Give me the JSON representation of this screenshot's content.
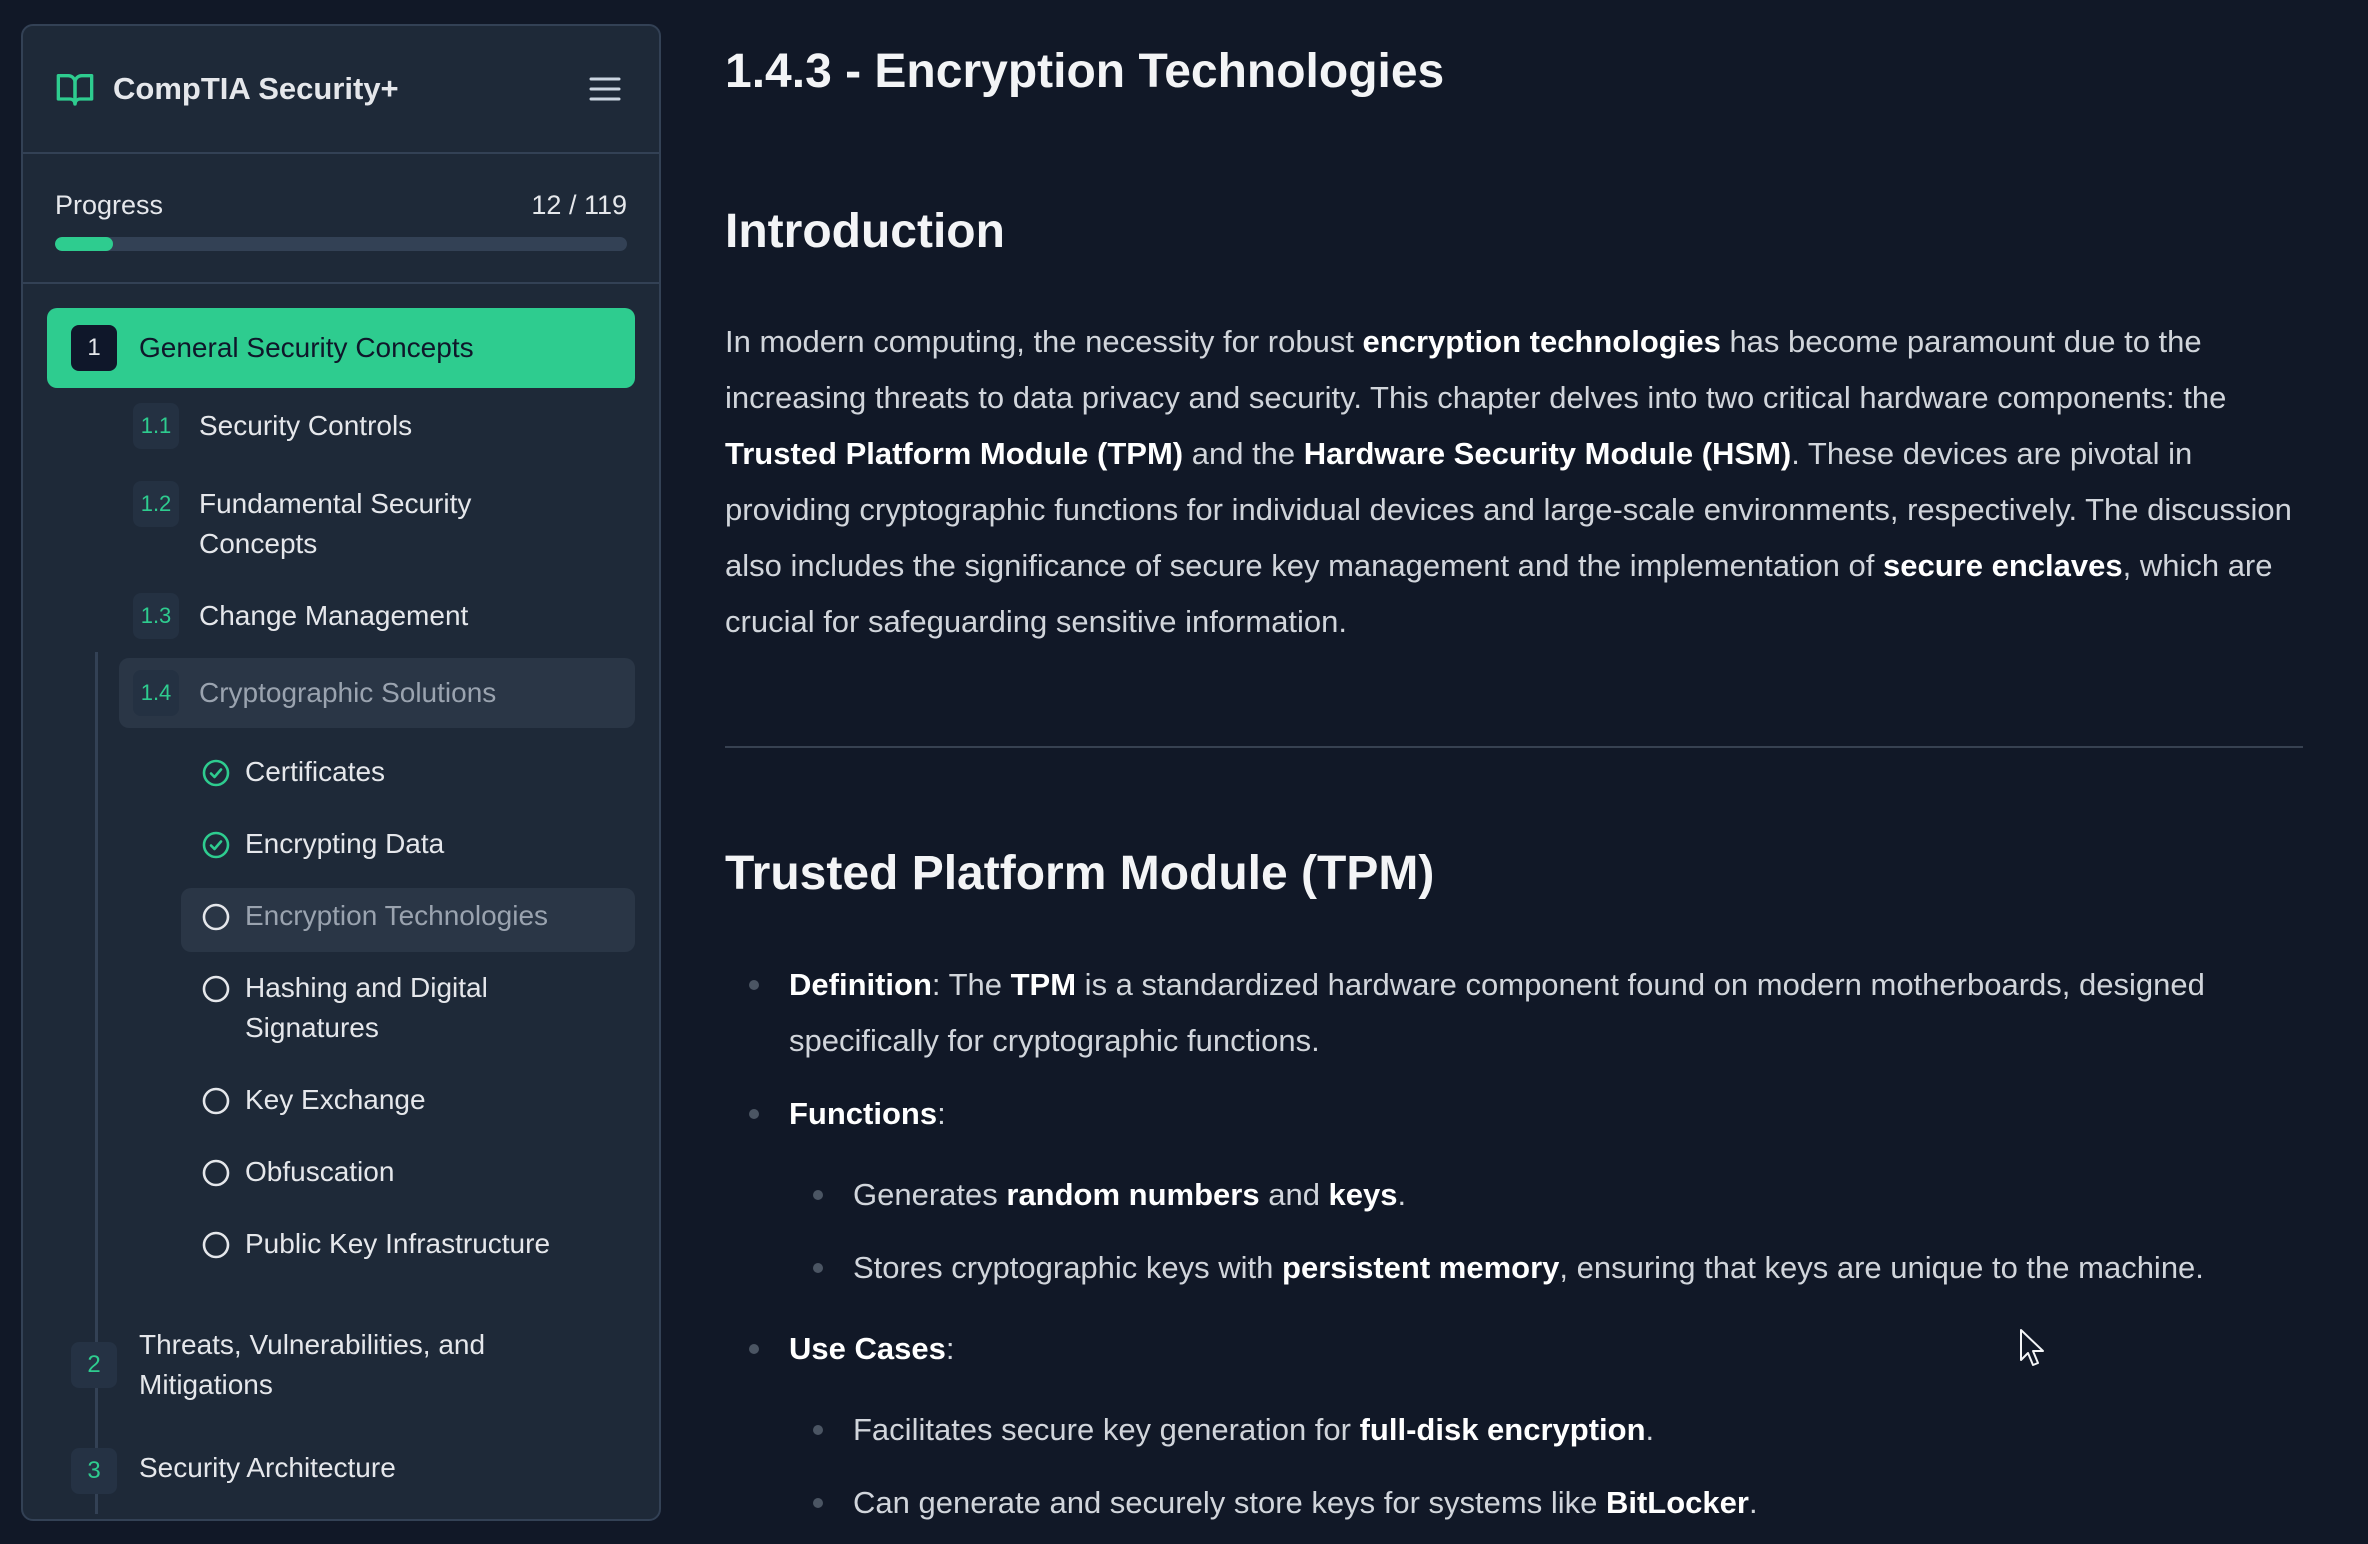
{
  "sidebar": {
    "title": "CompTIA Security+",
    "progress": {
      "label": "Progress",
      "count_text": "12 / 119",
      "completed": 12,
      "total": 119
    },
    "sections": [
      {
        "num": "1",
        "label": "General Security Concepts",
        "active": true,
        "subsections": [
          {
            "num": "1.1",
            "label": "Security Controls"
          },
          {
            "num": "1.2",
            "label": "Fundamental Security Concepts"
          },
          {
            "num": "1.3",
            "label": "Change Management"
          },
          {
            "num": "1.4",
            "label": "Cryptographic Solutions",
            "current": true,
            "lessons": [
              {
                "label": "Certificates",
                "status": "completed"
              },
              {
                "label": "Encrypting Data",
                "status": "completed"
              },
              {
                "label": "Encryption Technologies",
                "status": "current"
              },
              {
                "label": "Hashing and Digital Signatures",
                "status": "pending"
              },
              {
                "label": "Key Exchange",
                "status": "pending"
              },
              {
                "label": "Obfuscation",
                "status": "pending"
              },
              {
                "label": "Public Key Infrastructure",
                "status": "pending"
              }
            ]
          }
        ]
      },
      {
        "num": "2",
        "label": "Threats, Vulnerabilities, and Mitigations"
      },
      {
        "num": "3",
        "label": "Security Architecture"
      }
    ]
  },
  "content": {
    "page_title": "1.4.3 - Encryption Technologies",
    "intro": {
      "heading": "Introduction",
      "p1": "In modern computing, the necessity for robust ",
      "b1": "encryption technologies",
      "p2": " has become paramount due to the increasing threats to data privacy and security. This chapter delves into two critical hardware components: the ",
      "b2": "Trusted Platform Module (TPM)",
      "p3": " and the ",
      "b3": "Hardware Security Module (HSM)",
      "p4": ". These devices are pivotal in providing cryptographic functions for individual devices and large-scale environments, respectively. The discussion also includes the significance of secure key management and the implementation of ",
      "b4": "secure enclaves",
      "p5": ", which are crucial for safeguarding sensitive information."
    },
    "tpm": {
      "heading": "Trusted Platform Module (TPM)",
      "definition": {
        "term": "Definition",
        "t1": ": The ",
        "b1": "TPM",
        "t2": " is a standardized hardware component found on modern motherboards, designed specifically for cryptographic functions."
      },
      "functions": {
        "term": "Functions",
        "colon": ":",
        "item1": {
          "t1": "Generates ",
          "b1": "random numbers",
          "t2": " and ",
          "b2": "keys",
          "t3": "."
        },
        "item2": {
          "t1": "Stores cryptographic keys with ",
          "b1": "persistent memory",
          "t2": ", ensuring that keys are unique to the machine."
        }
      },
      "use_cases": {
        "term": "Use Cases",
        "colon": ":",
        "item1": {
          "t1": "Facilitates secure key generation for ",
          "b1": "full-disk encryption",
          "t2": "."
        },
        "item2": {
          "t1": "Can generate and securely store keys for systems like ",
          "b1": "BitLocker",
          "t2": "."
        }
      }
    }
  },
  "colors": {
    "accent": "#2ecc8f",
    "background": "#111827",
    "sidebar_bg": "#1e2938"
  },
  "icons": {
    "logo": "book-open-icon",
    "menu": "hamburger-menu-icon",
    "completed": "check-circle-icon",
    "pending": "circle-icon"
  }
}
